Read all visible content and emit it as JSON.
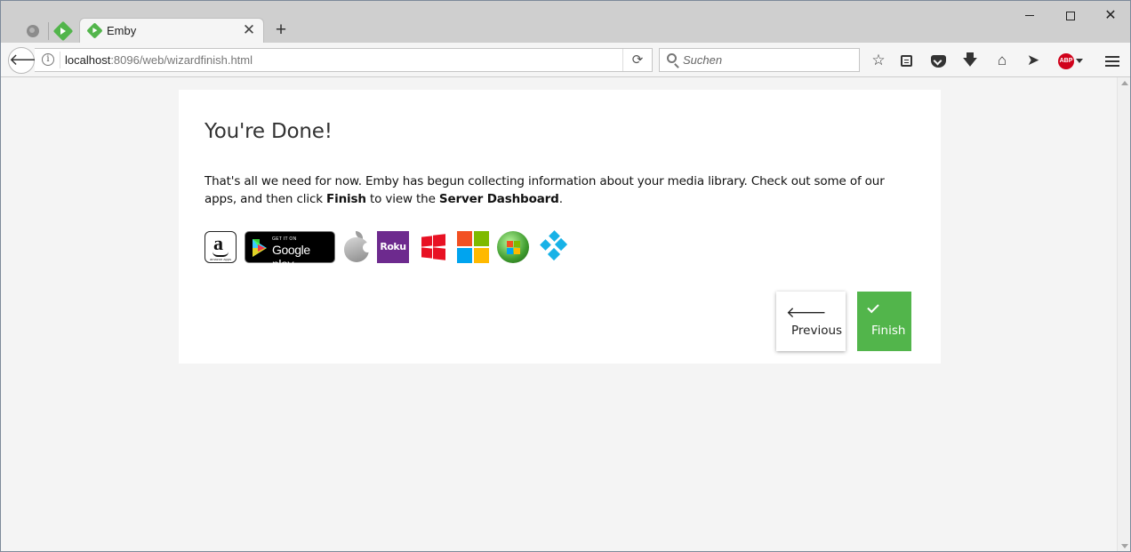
{
  "browser": {
    "active_tab": {
      "title": "Emby"
    },
    "url": {
      "host": "localhost",
      "rest": ":8096/web/wizardfinish.html"
    },
    "search": {
      "placeholder": "Suchen"
    },
    "abp_label": "ABP"
  },
  "wizard": {
    "title": "You're Done!",
    "intro": {
      "part1": "That's all we need for now. Emby has begun collecting information about your media library. Check out some of our apps, and then click ",
      "finish_word": "Finish",
      "part2": " to view the ",
      "dashboard_word": "Server Dashboard",
      "part3": "."
    },
    "apps": {
      "google_play_small": "GET IT ON",
      "google_play_big": "Google play",
      "roku": "Roku",
      "amazon_sub": "amazon apps"
    },
    "buttons": {
      "previous": "Previous",
      "finish": "Finish"
    }
  },
  "colors": {
    "accent": "#52b54b",
    "roku": "#6d2a8e",
    "windows": "#e81123",
    "kodi": "#17b2e7"
  },
  "icons": [
    "globe-icon",
    "emby-icon",
    "close-icon",
    "plus-icon",
    "back-arrow-icon",
    "info-icon",
    "reload-icon",
    "search-icon",
    "star-icon",
    "reader-icon",
    "pocket-icon",
    "download-icon",
    "home-icon",
    "send-icon",
    "adblock-icon",
    "menu-icon",
    "arrow-left-icon",
    "checkmark-icon"
  ]
}
